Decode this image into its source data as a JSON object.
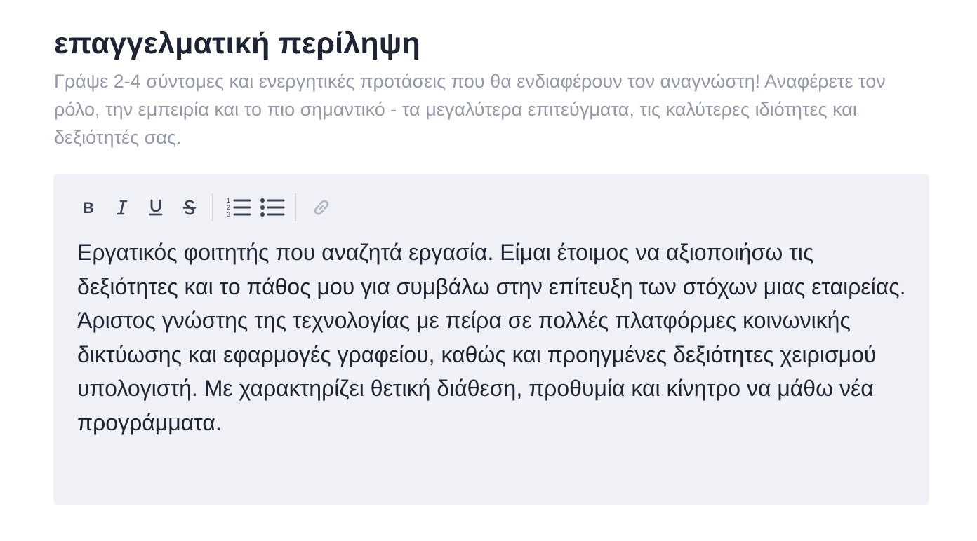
{
  "summary": {
    "title": "επαγγελματική περίληψη",
    "hint": "Γράψε 2-4 σύντομες και ενεργητικές προτάσεις που θα ενδιαφέρουν τον αναγνώστη! Αναφέρετε τον ρόλο, την εμπειρία και το πιο σημαντικό - τα μεγαλύτερα επιτεύγματα, τις καλύτερες ιδιότητες και δεξιότητές σας."
  },
  "editor": {
    "toolbar": [
      {
        "name": "bold-button",
        "icon": "bold-icon"
      },
      {
        "name": "italic-button",
        "icon": "italic-icon"
      },
      {
        "name": "underline-button",
        "icon": "underline-icon"
      },
      {
        "name": "strikethrough-button",
        "icon": "strikethrough-icon"
      },
      {
        "name": "ordered-list-button",
        "icon": "ordered-list-icon"
      },
      {
        "name": "bullet-list-button",
        "icon": "bullet-list-icon"
      },
      {
        "name": "link-button",
        "icon": "link-icon"
      }
    ],
    "content": "Εργατικός φοιτητής που αναζητά εργασία. Είμαι έτοιμος να αξιοποιήσω τις δεξιότητες και το πάθος μου για συμβάλω στην επίτευξη των στόχων μιας εταιρείας. Άριστος γνώστης της τεχνολογίας με πείρα σε πολλές πλατφόρμες κοινωνικής δικτύωσης και εφαρμογές γραφείου, καθώς και προηγμένες δεξιότητες χειρισμού υπολογιστή. Με χαρακτηρίζει θετική διάθεση, προθυμία και κίνητρο να μάθω νέα προγράμματα."
  },
  "colors": {
    "title": "#1e2433",
    "hint": "#9399a8",
    "editor_background": "#eff1f6",
    "icon_active": "#3a4152",
    "icon_disabled": "#b3b8c4"
  }
}
